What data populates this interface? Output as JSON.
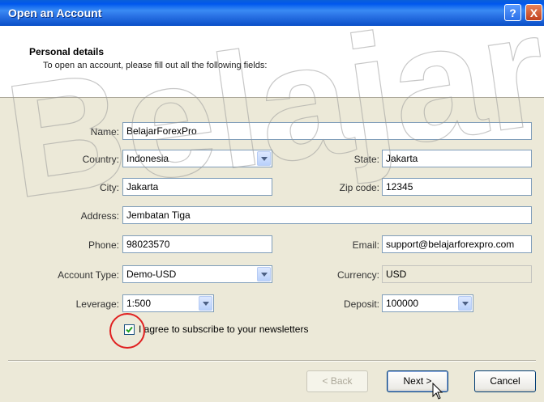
{
  "window": {
    "title": "Open an Account",
    "help_glyph": "?",
    "close_glyph": "X"
  },
  "header": {
    "title": "Personal details",
    "subtitle": "To open an account, please fill out all the following fields:"
  },
  "watermark": "Belajar",
  "form": {
    "name": {
      "label": "Name:",
      "value": "BelajarForexPro"
    },
    "country": {
      "label": "Country:",
      "value": "Indonesia"
    },
    "state": {
      "label": "State:",
      "value": "Jakarta"
    },
    "city": {
      "label": "City:",
      "value": "Jakarta"
    },
    "zip": {
      "label": "Zip code:",
      "value": "12345"
    },
    "address": {
      "label": "Address:",
      "value": "Jembatan Tiga"
    },
    "phone": {
      "label": "Phone:",
      "value": "98023570"
    },
    "email": {
      "label": "Email:",
      "value": "support@belajarforexpro.com"
    },
    "account_type": {
      "label": "Account Type:",
      "value": "Demo-USD"
    },
    "currency": {
      "label": "Currency:",
      "value": "USD"
    },
    "leverage": {
      "label": "Leverage:",
      "value": "1:500"
    },
    "deposit": {
      "label": "Deposit:",
      "value": "100000"
    },
    "newsletter": {
      "label": "I agree to subscribe to your newsletters",
      "checked": true
    }
  },
  "buttons": {
    "back": "< Back",
    "next": "Next >",
    "cancel": "Cancel"
  },
  "colors": {
    "titlebar": "#0058EE",
    "highlight_circle": "#E02020",
    "check": "#21A121"
  },
  "icons": {
    "help": "help-icon",
    "close": "close-icon",
    "dropdown": "chevron-down-icon",
    "cursor": "mouse-pointer-icon"
  }
}
